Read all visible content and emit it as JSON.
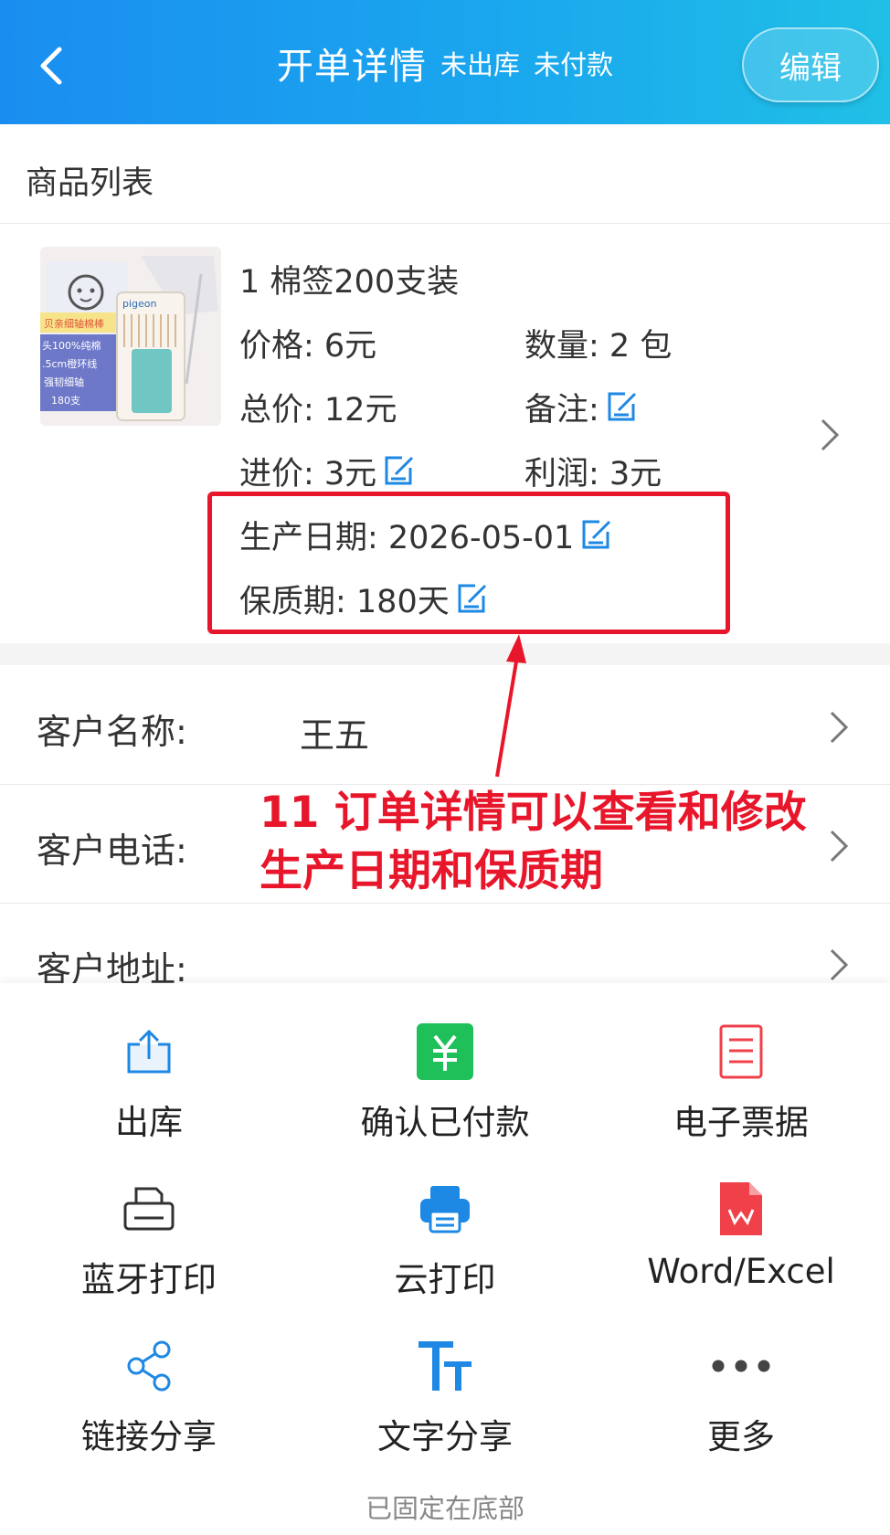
{
  "header": {
    "title": "开单详情",
    "status_outbound": "未出库",
    "status_payment": "未付款",
    "edit_label": "编辑"
  },
  "product_section": {
    "title": "商品列表",
    "item": {
      "name": "1 棉签200支装",
      "price": "价格: 6元",
      "quantity": "数量: 2 包",
      "total": "总价: 12元",
      "remark": "备注:",
      "cost": "进价: 3元",
      "profit": "利润: 3元",
      "production_date": "生产日期: 2026-05-01",
      "shelf_life": "保质期: 180天",
      "image_text": [
        "头100%纯棉",
        ".5cm橙环线",
        "强韧细轴",
        "180支"
      ],
      "image_brand": "pigeon",
      "image_tag": "贝亲细轴棉棒"
    }
  },
  "customer": {
    "name_label": "客户名称:",
    "name_value": "王五",
    "phone_label": "客户电话:",
    "address_label": "客户地址:"
  },
  "annotation": {
    "line1": "11 订单详情可以查看和修改",
    "line2": "生产日期和保质期"
  },
  "actions": [
    {
      "label": "出库",
      "icon": "export-icon"
    },
    {
      "label": "确认已付款",
      "icon": "yuan-payment-icon"
    },
    {
      "label": "电子票据",
      "icon": "receipt-icon"
    },
    {
      "label": "蓝牙打印",
      "icon": "printer-icon"
    },
    {
      "label": "云打印",
      "icon": "cloud-printer-icon"
    },
    {
      "label": "Word/Excel",
      "icon": "document-w-icon"
    },
    {
      "label": "链接分享",
      "icon": "share-icon"
    },
    {
      "label": "文字分享",
      "icon": "text-size-icon"
    },
    {
      "label": "更多",
      "icon": "more-dots-icon"
    }
  ],
  "footer": {
    "pinned_label": "已固定在底部"
  },
  "colors": {
    "header_start": "#1a8ef0",
    "header_end": "#20c0e6",
    "accent_blue": "#1e88e5",
    "annotation_red": "#e8162b",
    "payment_green": "#1fc05a",
    "doc_red": "#f0404a"
  }
}
